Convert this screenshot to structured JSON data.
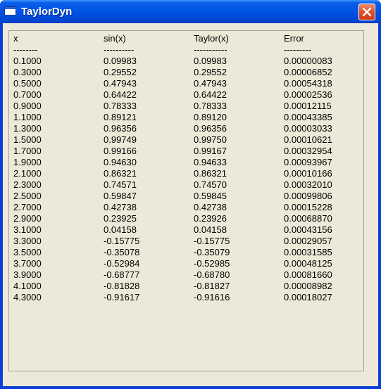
{
  "window": {
    "title": "TaylorDyn",
    "icon": "window-icon",
    "close_icon": "close-x-icon"
  },
  "table": {
    "headers": [
      "x",
      "sin(x)",
      "Taylor(x)",
      "Error"
    ],
    "separators": [
      "--------",
      "----------",
      "-----------",
      "---------"
    ],
    "rows": [
      [
        "0.1000",
        "0.09983",
        "0.09983",
        "0.00000083"
      ],
      [
        "0.3000",
        "0.29552",
        "0.29552",
        "0.00006852"
      ],
      [
        "0.5000",
        "0.47943",
        "0.47943",
        "0.00054318"
      ],
      [
        "0.7000",
        "0.64422",
        "0.64422",
        "0.00002536"
      ],
      [
        "0.9000",
        "0.78333",
        "0.78333",
        "0.00012115"
      ],
      [
        "1.1000",
        "0.89121",
        "0.89120",
        "0.00043385"
      ],
      [
        "1.3000",
        "0.96356",
        "0.96356",
        "0.00003033"
      ],
      [
        "1.5000",
        "0.99749",
        "0.99750",
        "0.00010621"
      ],
      [
        "1.7000",
        "0.99166",
        "0.99167",
        "0.00032954"
      ],
      [
        "1.9000",
        "0.94630",
        "0.94633",
        "0.00093967"
      ],
      [
        "2.1000",
        "0.86321",
        "0.86321",
        "0.00010166"
      ],
      [
        "2.3000",
        "0.74571",
        "0.74570",
        "0.00032010"
      ],
      [
        "2.5000",
        "0.59847",
        "0.59845",
        "0.00099806"
      ],
      [
        "2.7000",
        "0.42738",
        "0.42738",
        "0.00015228"
      ],
      [
        "2.9000",
        "0.23925",
        "0.23926",
        "0.00068870"
      ],
      [
        "3.1000",
        "0.04158",
        "0.04158",
        "0.00043156"
      ],
      [
        "3.3000",
        "-0.15775",
        "-0.15775",
        "0.00029057"
      ],
      [
        "3.5000",
        "-0.35078",
        "-0.35079",
        "0.00031585"
      ],
      [
        "3.7000",
        "-0.52984",
        "-0.52985",
        "0.00048125"
      ],
      [
        "3.9000",
        "-0.68777",
        "-0.68780",
        "0.00081660"
      ],
      [
        "4.1000",
        "-0.81828",
        "-0.81827",
        "0.00008982"
      ],
      [
        "4.3000",
        "-0.91617",
        "-0.91616",
        "0.00018027"
      ]
    ]
  },
  "colors": {
    "titlebar": "#0055e5",
    "client_bg": "#ece9d8",
    "close_button": "#e0542c"
  }
}
